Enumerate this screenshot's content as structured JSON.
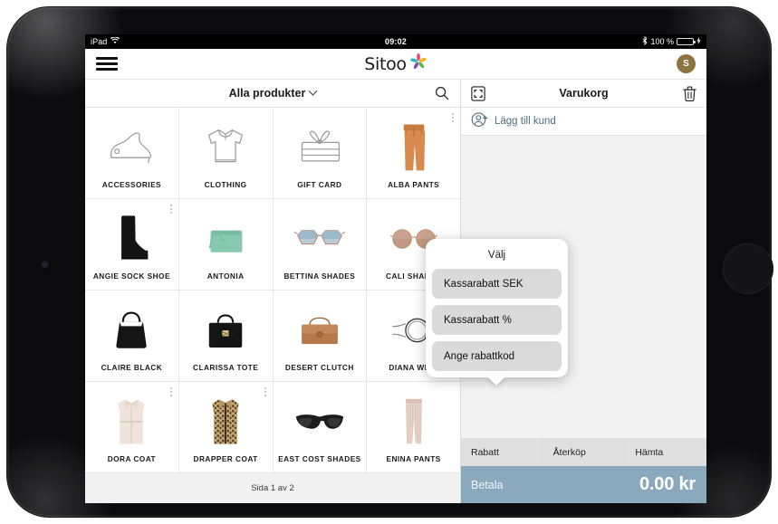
{
  "status_bar": {
    "device_label": "iPad",
    "wifi_icon": "wifi-icon",
    "time": "09:02",
    "bluetooth_icon": "bluetooth-icon",
    "battery_percent": "100 %",
    "charging_icon": "charging-bolt-icon"
  },
  "app_bar": {
    "menu_icon": "hamburger-menu-icon",
    "logo_text": "Sitoo",
    "logo_mark": "sitoo-star-icon",
    "avatar_initial": "S"
  },
  "products_panel": {
    "category_label": "Alla produkter",
    "category_chevron": "chevron-down-icon",
    "search_icon": "search-icon",
    "pagination": "Sida 1 av 2",
    "items": [
      {
        "label": "ACCESSORIES",
        "art": "high-heel-shoe-outline",
        "kebab": false
      },
      {
        "label": "CLOTHING",
        "art": "tshirt-outline",
        "kebab": false
      },
      {
        "label": "GIFT CARD",
        "art": "gift-card-outline",
        "kebab": false
      },
      {
        "label": "ALBA PANTS",
        "art": "orange-wide-pants",
        "kebab": true
      },
      {
        "label": "ANGIE SOCK SHOE",
        "art": "black-ankle-boot",
        "kebab": true
      },
      {
        "label": "ANTONIA",
        "art": "mint-crossbody-bag",
        "kebab": false
      },
      {
        "label": "BETTINA SHADES",
        "art": "hexagon-sunglasses",
        "kebab": false
      },
      {
        "label": "CALI SHADES",
        "art": "round-sunglasses",
        "kebab": false
      },
      {
        "label": "CLAIRE BLACK",
        "art": "black-hobo-bag",
        "kebab": false
      },
      {
        "label": "CLARISSA TOTE",
        "art": "black-structured-tote",
        "kebab": false
      },
      {
        "label": "DESERT CLUTCH",
        "art": "tan-leather-clutch",
        "kebab": false
      },
      {
        "label": "DIANA WRIS",
        "art": "wrap-bracelet",
        "kebab": false
      },
      {
        "label": "DORA COAT",
        "art": "cream-wrap-coat",
        "kebab": true
      },
      {
        "label": "DRAPPER COAT",
        "art": "leopard-print-coat",
        "kebab": true
      },
      {
        "label": "EAST COST SHADES",
        "art": "black-cateye-sunglasses",
        "kebab": false
      },
      {
        "label": "ENINA PANTS",
        "art": "pink-striped-pants",
        "kebab": false
      }
    ]
  },
  "cart_panel": {
    "scan_icon": "scan-barcode-icon",
    "title": "Varukorg",
    "trash_icon": "trash-icon",
    "add_customer_icon": "add-person-icon",
    "add_customer_label": "Lägg till kund",
    "actions": [
      {
        "label": "Rabatt"
      },
      {
        "label": "Återköp"
      },
      {
        "label": "Hämta"
      }
    ],
    "pay_label": "Betala",
    "pay_amount": "0.00 kr"
  },
  "popup": {
    "title": "Välj",
    "options": [
      {
        "label": "Kassarabatt SEK"
      },
      {
        "label": "Kassarabatt %"
      },
      {
        "label": "Ange rabattkod"
      }
    ]
  },
  "colors": {
    "pay_bar": "#8aa9bd",
    "accent_link": "#4c6e80",
    "avatar": "#8d7340",
    "battery": "#4cd964"
  }
}
